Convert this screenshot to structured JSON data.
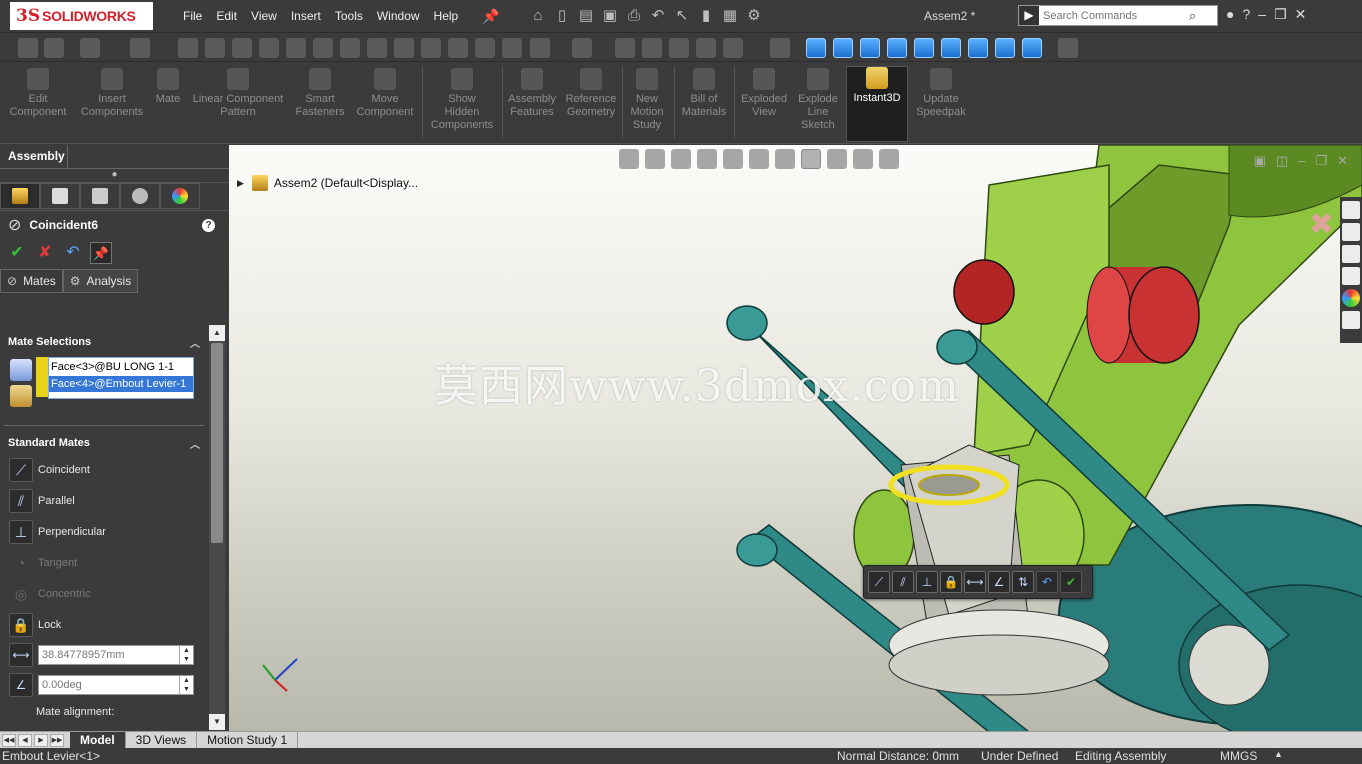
{
  "app": {
    "logo_ds": "3S",
    "logo_text": "SOLIDWORKS",
    "doc_title": "Assem2 *"
  },
  "menu": [
    "File",
    "Edit",
    "View",
    "Insert",
    "Tools",
    "Window",
    "Help"
  ],
  "search": {
    "placeholder": "Search Commands"
  },
  "command_manager": [
    {
      "label": "Edit\nComponent",
      "enabled": false
    },
    {
      "label": "Insert\nComponents",
      "enabled": false
    },
    {
      "label": "Mate",
      "enabled": false
    },
    {
      "label": "Linear Component\nPattern",
      "enabled": false
    },
    {
      "label": "Smart\nFasteners",
      "enabled": false
    },
    {
      "label": "Move\nComponent",
      "enabled": false
    },
    {
      "label": "Show\nHidden\nComponents",
      "enabled": false
    },
    {
      "label": "Assembly\nFeatures",
      "enabled": false
    },
    {
      "label": "Reference\nGeometry",
      "enabled": false
    },
    {
      "label": "New\nMotion\nStudy",
      "enabled": false
    },
    {
      "label": "Bill of\nMaterials",
      "enabled": false
    },
    {
      "label": "Exploded\nView",
      "enabled": false
    },
    {
      "label": "Explode\nLine\nSketch",
      "enabled": false
    },
    {
      "label": "Instant3D",
      "enabled": true,
      "active": true
    },
    {
      "label": "Update\nSpeedpak",
      "enabled": false
    }
  ],
  "left_panel": {
    "tab": "Assembly",
    "dots": "●",
    "pm_title": "Coincident6",
    "help": "?",
    "subtabs": {
      "mates": "Mates",
      "analysis": "Analysis"
    },
    "mate_selections": {
      "title": "Mate Selections",
      "items": [
        "Face<3>@BU LONG 1-1",
        "Face<4>@Embout Levier-1"
      ]
    },
    "standard_mates": {
      "title": "Standard Mates",
      "items": [
        {
          "label": "Coincident",
          "enabled": true
        },
        {
          "label": "Parallel",
          "enabled": true
        },
        {
          "label": "Perpendicular",
          "enabled": true
        },
        {
          "label": "Tangent",
          "enabled": false
        },
        {
          "label": "Concentric",
          "enabled": false
        },
        {
          "label": "Lock",
          "enabled": true
        }
      ],
      "distance_value": "38.84778957mm",
      "angle_value": "0.00deg",
      "mate_alignment": "Mate alignment:"
    }
  },
  "viewport": {
    "tree_item": "Assem2  (Default<Display...",
    "watermark": "莫西网www.3dmox.com"
  },
  "bottom_tabs": [
    "Model",
    "3D Views",
    "Motion Study 1"
  ],
  "status": {
    "selected": "Embout Levier<1>",
    "normal_distance": "Normal Distance: 0mm",
    "state": "Under Defined",
    "mode": "Editing Assembly",
    "units": "MMGS"
  },
  "colors": {
    "accent_selection": "#3577d6",
    "part_green": "#8fc43e",
    "part_teal": "#2a7c7a",
    "part_red": "#c83232",
    "highlight_yellow": "#e8d21a"
  }
}
